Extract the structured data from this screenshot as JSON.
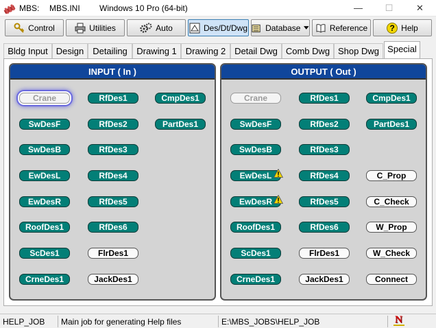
{
  "titlebar": {
    "app_name": "MBS:",
    "file_name": "MBS.INI",
    "os_info": "Windows 10 Pro (64-bit)",
    "minimize": "—",
    "maximize": "☐",
    "close": "✕"
  },
  "toolbar": {
    "control": "Control",
    "utilities": "Utilities",
    "auto": "Auto",
    "des_dt_dwg": "Des/Dt/Dwg",
    "database": "Database",
    "reference": "Reference",
    "help": "Help",
    "help_glyph": "?"
  },
  "tabs": [
    "Bldg Input",
    "Design",
    "Detailing",
    "Drawing 1",
    "Drawing 2",
    "Detail Dwg",
    "Comb Dwg",
    "Shop Dwg",
    "Special"
  ],
  "selected_tab": "Special",
  "input_panel": {
    "title": "INPUT ( In )",
    "buttons": {
      "crane": "Crane",
      "rfdes1": "RfDes1",
      "cmpdes1": "CmpDes1",
      "swdesf": "SwDesF",
      "rfdes2": "RfDes2",
      "partdes1": "PartDes1",
      "swdesb": "SwDesB",
      "rfdes3": "RfDes3",
      "ewdesl": "EwDesL",
      "rfdes4": "RfDes4",
      "ewdesr": "EwDesR",
      "rfdes5": "RfDes5",
      "roofdes1": "RoofDes1",
      "rfdes6": "RfDes6",
      "scdes1": "ScDes1",
      "flrdes1": "FlrDes1",
      "crnedes1": "CrneDes1",
      "jackdes1": "JackDes1"
    }
  },
  "output_panel": {
    "title": "OUTPUT ( Out )",
    "buttons": {
      "crane": "Crane",
      "rfdes1": "RfDes1",
      "cmpdes1": "CmpDes1",
      "swdesf": "SwDesF",
      "rfdes2": "RfDes2",
      "partdes1": "PartDes1",
      "swdesb": "SwDesB",
      "rfdes3": "RfDes3",
      "ewdesl": "EwDesL",
      "rfdes4": "RfDes4",
      "c_prop": "C_Prop",
      "ewdesr": "EwDesR",
      "rfdes5": "RfDes5",
      "c_check": "C_Check",
      "roofdes1": "RoofDes1",
      "rfdes6": "RfDes6",
      "w_prop": "W_Prop",
      "scdes1": "ScDes1",
      "flrdes1": "FlrDes1",
      "w_check": "W_Check",
      "crnedes1": "CrneDes1",
      "jackdes1": "JackDes1",
      "connect": "Connect"
    }
  },
  "statusbar": {
    "job": "HELP_JOB",
    "description": "Main job for generating Help files",
    "path": "E:\\MBS_JOBS\\HELP_JOB",
    "logo_letter": "N"
  },
  "colors": {
    "panel_header": "#10469b",
    "teal_button": "#037f77",
    "panel_bg": "#d4d4d4",
    "warning": "#f2d600"
  },
  "icons": [
    "mbs-app-icon",
    "key-icon",
    "printer-icon",
    "gears-icon",
    "drawing-icon",
    "database-icon",
    "dropdown-arrow-icon",
    "book-icon",
    "help-icon",
    "warning-icon",
    "n-logo-icon"
  ]
}
